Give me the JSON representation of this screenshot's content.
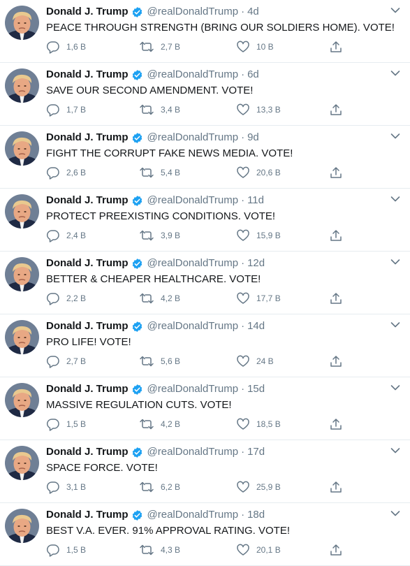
{
  "colors": {
    "verified": "#1da1f2",
    "muted": "#657786",
    "text": "#14171a",
    "divider": "#e6ecf0"
  },
  "icons": {
    "reply": "speech-bubble-icon",
    "retweet": "retweet-arrows-icon",
    "like": "heart-icon",
    "share": "share-upload-icon",
    "verified": "verified-badge-icon",
    "menu": "chevron-down-icon"
  },
  "tweets": [
    {
      "name": "Donald J. Trump",
      "handle": "@realDonaldTrump",
      "time": "4d",
      "text": "PEACE THROUGH STRENGTH (BRING OUR SOLDIERS HOME). VOTE!",
      "replies": "1,6 B",
      "retweets": "2,7 B",
      "likes": "10 B"
    },
    {
      "name": "Donald J. Trump",
      "handle": "@realDonaldTrump",
      "time": "6d",
      "text": "SAVE OUR SECOND AMENDMENT. VOTE!",
      "replies": "1,7 B",
      "retweets": "3,4 B",
      "likes": "13,3 B"
    },
    {
      "name": "Donald J. Trump",
      "handle": "@realDonaldTrump",
      "time": "9d",
      "text": "FIGHT THE CORRUPT FAKE NEWS MEDIA. VOTE!",
      "replies": "2,6 B",
      "retweets": "5,4 B",
      "likes": "20,6 B"
    },
    {
      "name": "Donald J. Trump",
      "handle": "@realDonaldTrump",
      "time": "11d",
      "text": "PROTECT PREEXISTING CONDITIONS. VOTE!",
      "replies": "2,4 B",
      "retweets": "3,9 B",
      "likes": "15,9 B"
    },
    {
      "name": "Donald J. Trump",
      "handle": "@realDonaldTrump",
      "time": "12d",
      "text": "BETTER & CHEAPER HEALTHCARE. VOTE!",
      "replies": "2,2 B",
      "retweets": "4,2 B",
      "likes": "17,7 B"
    },
    {
      "name": "Donald J. Trump",
      "handle": "@realDonaldTrump",
      "time": "14d",
      "text": "PRO LIFE! VOTE!",
      "replies": "2,7 B",
      "retweets": "5,6 B",
      "likes": "24 B"
    },
    {
      "name": "Donald J. Trump",
      "handle": "@realDonaldTrump",
      "time": "15d",
      "text": "MASSIVE REGULATION CUTS. VOTE!",
      "replies": "1,5 B",
      "retweets": "4,2 B",
      "likes": "18,5 B"
    },
    {
      "name": "Donald J. Trump",
      "handle": "@realDonaldTrump",
      "time": "17d",
      "text": "SPACE FORCE. VOTE!",
      "replies": "3,1 B",
      "retweets": "6,2 B",
      "likes": "25,9 B"
    },
    {
      "name": "Donald J. Trump",
      "handle": "@realDonaldTrump",
      "time": "18d",
      "text": "BEST V.A. EVER. 91% APPROVAL RATING. VOTE!",
      "replies": "1,5 B",
      "retweets": "4,3 B",
      "likes": "20,1 B"
    }
  ]
}
